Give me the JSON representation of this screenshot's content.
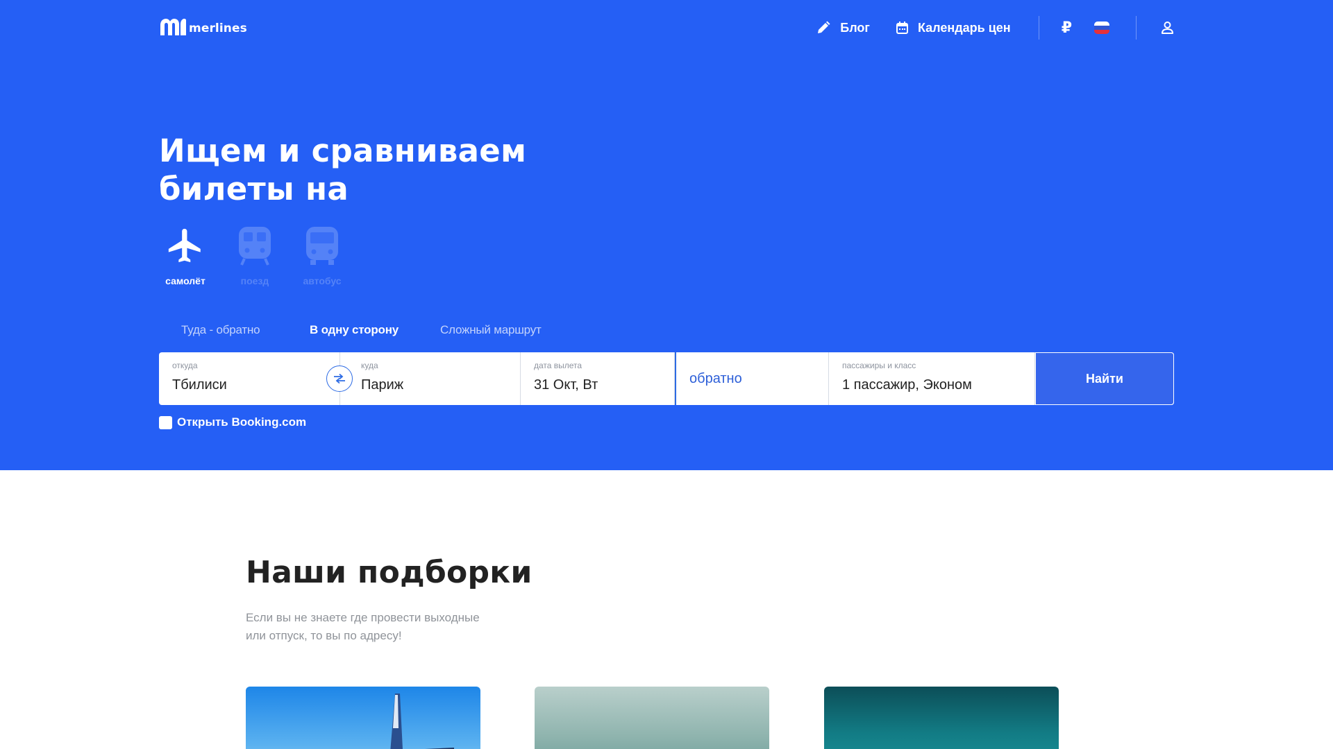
{
  "brand": {
    "name": "merlines"
  },
  "nav": {
    "blog": "Блог",
    "calendar": "Календарь цен",
    "currency": "₽"
  },
  "hero": {
    "headline_line1": "Ищем и сравниваем",
    "headline_line2": "билеты на",
    "background_color": "#255ff5"
  },
  "transport": [
    {
      "label": "самолёт",
      "icon": "airplane-icon",
      "active": true
    },
    {
      "label": "поезд",
      "icon": "train-icon",
      "active": false
    },
    {
      "label": "автобус",
      "icon": "bus-icon",
      "active": false
    }
  ],
  "trip_tabs": [
    {
      "label": "Туда - обратно",
      "active": false
    },
    {
      "label": "В одну сторону",
      "active": true
    },
    {
      "label": "Сложный маршрут",
      "active": false
    }
  ],
  "search": {
    "from_label": "откуда",
    "from_value": "Тбилиси",
    "to_label": "куда",
    "to_value": "Париж",
    "date_label": "дата вылета",
    "date_value": "31 Окт, Вт",
    "return_placeholder": "обратно",
    "pax_label": "пассажиры и класс",
    "pax_value": "1 пассажир, Эконом",
    "submit": "Найти"
  },
  "booking_checkbox": {
    "label": "Открыть Booking.com",
    "checked": false
  },
  "collections": {
    "title": "Наши подборки",
    "subtitle_line1": "Если вы не знаете где провести выходные",
    "subtitle_line2": "или отпуск, то вы по адресу!"
  }
}
